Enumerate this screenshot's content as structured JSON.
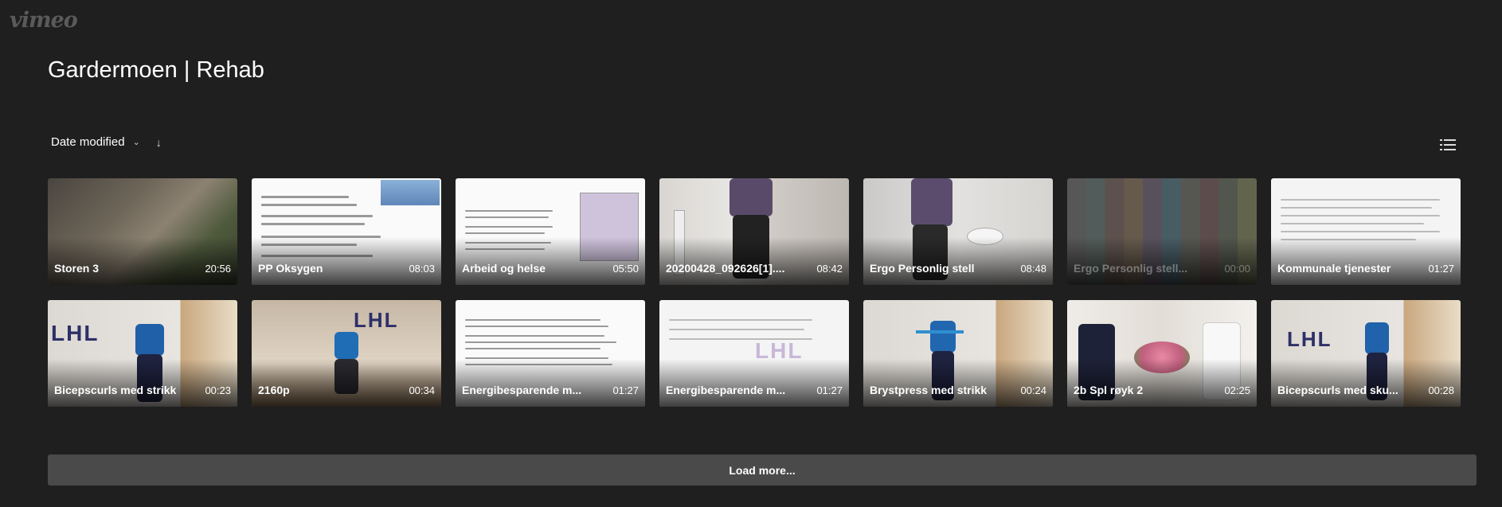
{
  "brand": {
    "logo_text": "vimeo"
  },
  "page": {
    "title": "Gardermoen | Rehab"
  },
  "sort": {
    "label": "Date modified",
    "chevron_icon": "chevron-down-icon",
    "direction_icon": "arrow-down-icon"
  },
  "view_toggle": {
    "icon": "list-view-icon"
  },
  "videos": [
    {
      "title": "Storen 3",
      "duration": "20:56"
    },
    {
      "title": "PP Oksygen",
      "duration": "08:03"
    },
    {
      "title": "Arbeid og helse",
      "duration": "05:50"
    },
    {
      "title": "20200428_092626[1]....",
      "duration": "08:42"
    },
    {
      "title": "Ergo Personlig stell",
      "duration": "08:48"
    },
    {
      "title": "Ergo Personlig stell...",
      "duration": "00:00"
    },
    {
      "title": "Kommunale tjenester",
      "duration": "01:27"
    },
    {
      "title": "Bicepscurls med strikk",
      "duration": "00:23"
    },
    {
      "title": "2160p",
      "duration": "00:34"
    },
    {
      "title": "Energibesparende m...",
      "duration": "01:27"
    },
    {
      "title": "Energibesparende m...",
      "duration": "01:27"
    },
    {
      "title": "Brystpress med strikk",
      "duration": "00:24"
    },
    {
      "title": "2b Spl røyk 2",
      "duration": "02:25"
    },
    {
      "title": "Bicepscurls med sku...",
      "duration": "00:28"
    }
  ],
  "load_more": {
    "label": "Load more..."
  }
}
